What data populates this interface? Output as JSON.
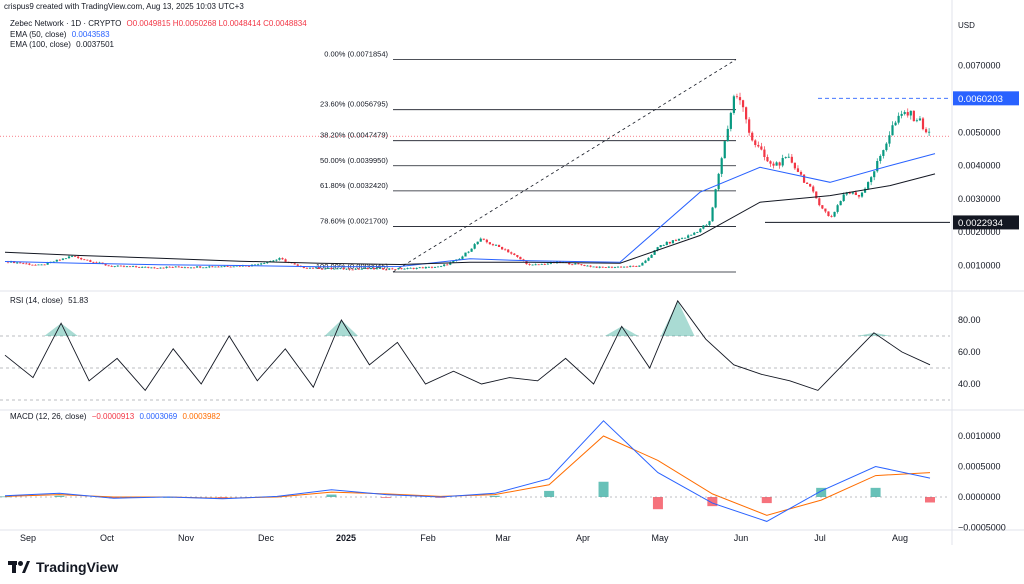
{
  "header": {
    "text": "crispus9 created with TradingView.com, Aug 13, 2025 10:03 UTC+3"
  },
  "symbol": {
    "name": "Zebec Network · 1D · CRYPTO",
    "ohlc": "O0.0049815 H0.0050268 L0.0048414 C0.0048834",
    "color_up": "#089981",
    "color_down": "#f23645"
  },
  "indicators": {
    "ema50": {
      "label": "EMA (50, close)",
      "value": "0.0043583",
      "color": "#2962ff"
    },
    "ema100": {
      "label": "EMA (100, close)",
      "value": "0.0037501",
      "color": "#131722"
    },
    "rsi": {
      "label": "RSI (14, close)",
      "value": "51.83"
    },
    "macd": {
      "label": "MACD (12, 26, close)",
      "hist": "−0.0000913",
      "macd": "0.0003069",
      "signal": "0.0003982",
      "macd_color": "#2962ff",
      "signal_color": "#ff6d00"
    }
  },
  "price_axis": {
    "currency": "USD",
    "ticks": [
      "0.0070000",
      "0.0050000",
      "0.0040000",
      "0.0030000",
      "0.0020000",
      "0.0010000"
    ],
    "badges": [
      {
        "label": "0.0060203",
        "value": 0.0060203,
        "bg": "#2962ff",
        "fg": "#ffffff"
      },
      {
        "label": "0.0022934",
        "value": 0.0022934,
        "bg": "#131722",
        "fg": "#ffffff"
      }
    ]
  },
  "rsi_axis": {
    "ticks": [
      "80.00",
      "60.00",
      "40.00"
    ]
  },
  "macd_axis": {
    "ticks": [
      "0.0010000",
      "0.0005000",
      "0.0000000",
      "−0.0005000"
    ]
  },
  "time_axis": [
    "Sep",
    "Oct",
    "Nov",
    "Dec",
    "2025",
    "Feb",
    "Mar",
    "Apr",
    "May",
    "Jun",
    "Jul",
    "Aug"
  ],
  "fibonacci": [
    {
      "label": "0.00% (0.0071854)",
      "value": 0.0071854
    },
    {
      "label": "23.60% (0.0056795)",
      "value": 0.0056795
    },
    {
      "label": "38.20% (0.0047479)",
      "value": 0.0047479
    },
    {
      "label": "50.00% (0.0039950)",
      "value": 0.003995
    },
    {
      "label": "61.80% (0.0032420)",
      "value": 0.003242
    },
    {
      "label": "78.60% (0.0021700)",
      "value": 0.00217
    },
    {
      "label": "100.00% (0.0008045)",
      "value": 0.0008045
    }
  ],
  "branding": {
    "name": "TradingView"
  },
  "chart_data": [
    {
      "type": "line",
      "title": "Zebec Network · 1D · CRYPTO",
      "ylim": [
        0.0001,
        0.0078
      ],
      "x": [
        "Sep",
        "Oct",
        "Nov",
        "Dec",
        "2025",
        "Feb",
        "Mar",
        "Apr",
        "May",
        "Jun",
        "Jul",
        "Aug"
      ],
      "series": [
        {
          "name": "Zebec Network",
          "values": [
            0.00112,
            0.00104,
            0.00095,
            0.001,
            0.00092,
            0.00098,
            0.00178,
            0.00098,
            0.001,
            0.0062,
            0.00375,
            0.0033,
            0.0056,
            0.00488
          ]
        },
        {
          "name": "EMA (50, close)",
          "values": [
            0.00112,
            0.00107,
            0.00102,
            0.001,
            0.00096,
            0.00097,
            0.0012,
            0.00114,
            0.0011,
            0.0032,
            0.00395,
            0.0035,
            0.004,
            0.00436
          ]
        },
        {
          "name": "EMA (100, close)",
          "values": [
            0.0014,
            0.0013,
            0.00122,
            0.00113,
            0.00107,
            0.00103,
            0.0011,
            0.0011,
            0.00107,
            0.0019,
            0.0029,
            0.0031,
            0.0034,
            0.00375
          ]
        }
      ],
      "fib_levels": [
        0.0071854,
        0.0056795,
        0.0047479,
        0.003995,
        0.003242,
        0.00217,
        0.0008045
      ],
      "marked_levels": [
        0.0060203,
        0.0022934
      ]
    },
    {
      "type": "line",
      "title": "RSI (14, close)",
      "ylim": [
        25,
        90
      ],
      "series": [
        {
          "name": "RSI (14, close)",
          "values": [
            58,
            44,
            78,
            42,
            56,
            36,
            62,
            40,
            70,
            42,
            62,
            38,
            80,
            52,
            66,
            40,
            48,
            40,
            44,
            42,
            56,
            40,
            76,
            50,
            92,
            68,
            52,
            46,
            42,
            36,
            54,
            72,
            60,
            52
          ]
        }
      ],
      "reference_lines": [
        70,
        50,
        30
      ]
    },
    {
      "type": "bar",
      "title": "MACD (12, 26, close)",
      "ylim": [
        -0.00055,
        0.00135
      ],
      "series": [
        {
          "name": "MACD",
          "values": [
            2e-05,
            6e-05,
            -2e-05,
            0.0,
            -3e-05,
            1e-05,
            0.00012,
            4e-05,
            0.0,
            6e-05,
            0.0003,
            0.00125,
            0.0004,
            -0.0001,
            -0.0004,
            0.0001,
            0.0005,
            0.00031
          ]
        },
        {
          "name": "Signal",
          "values": [
            1e-05,
            4e-05,
            0.0,
            0.0,
            -2e-05,
            0.0,
            8e-05,
            5e-05,
            1e-05,
            4e-05,
            0.0002,
            0.001,
            0.0006,
            5e-05,
            -0.0003,
            -5e-05,
            0.00035,
            0.0004
          ]
        },
        {
          "name": "Histogram",
          "values": [
            1e-05,
            2e-05,
            -2e-05,
            0.0,
            -1e-05,
            1e-05,
            4e-05,
            -1e-05,
            -1e-05,
            2e-05,
            0.0001,
            0.00025,
            -0.0002,
            -0.00015,
            -0.0001,
            0.00015,
            0.00015,
            -9e-05
          ]
        }
      ]
    }
  ]
}
